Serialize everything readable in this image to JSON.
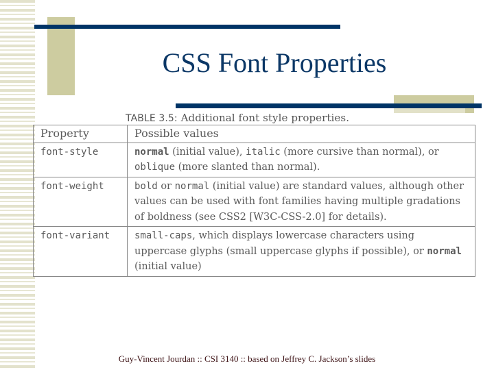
{
  "slide": {
    "title": "CSS Font Properties",
    "footer": "Guy-Vincent Jourdan :: CSI 3140 :: based on Jeffrey C. Jackson’s slides",
    "colors": {
      "navy": "#003466",
      "tan": "#cdcca0",
      "title_text": "#0b3766",
      "footer_text": "#3b0f12"
    }
  },
  "table": {
    "caption_label": "TABLE 3.5:",
    "caption_text": " Additional font style properties.",
    "headers": [
      "Property",
      "Possible values"
    ],
    "rows": [
      {
        "property": "font-style",
        "v1": "normal",
        "t1": " (initial value), ",
        "v2": "italic",
        "t2": " (more cursive than normal), or ",
        "v3": "oblique",
        "t3": " (more slanted than normal)."
      },
      {
        "property": "font-weight",
        "v1": "bold",
        "t1": " or ",
        "v2": "normal",
        "t2": " (initial value) are standard values, although other values can be used with font families having multiple gradations of boldness (see CSS2 [W3C-CSS-2.0] for details)."
      },
      {
        "property": "font-variant",
        "v1": "small-caps",
        "t1": ", which displays lowercase characters using uppercase glyphs (small uppercase glyphs if possible), or ",
        "v2": "normal",
        "t2": " (initial value)"
      }
    ]
  }
}
